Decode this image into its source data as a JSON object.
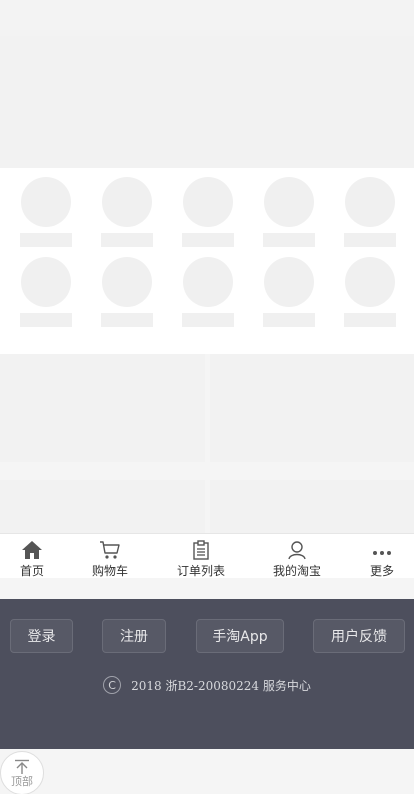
{
  "tabs": [
    {
      "label": "首页",
      "icon": "home-icon"
    },
    {
      "label": "购物车",
      "icon": "cart-icon"
    },
    {
      "label": "订单列表",
      "icon": "order-list-icon"
    },
    {
      "label": "我的淘宝",
      "icon": "user-icon"
    },
    {
      "label": "更多",
      "icon": "more-icon"
    }
  ],
  "footer": {
    "buttons": [
      {
        "label": "登录"
      },
      {
        "label": "注册"
      },
      {
        "label": "手淘App"
      },
      {
        "label": "用户反馈"
      }
    ],
    "copyright_symbol": "C",
    "copyright_text": "2018 浙B2-20080224 服务中心"
  },
  "back_to_top": {
    "label": "顶部",
    "icon": "arrow-up-icon"
  },
  "colors": {
    "footer_bg": "#4d4f5d",
    "placeholder": "#f0f0f0",
    "tab_icon": "#555555"
  }
}
